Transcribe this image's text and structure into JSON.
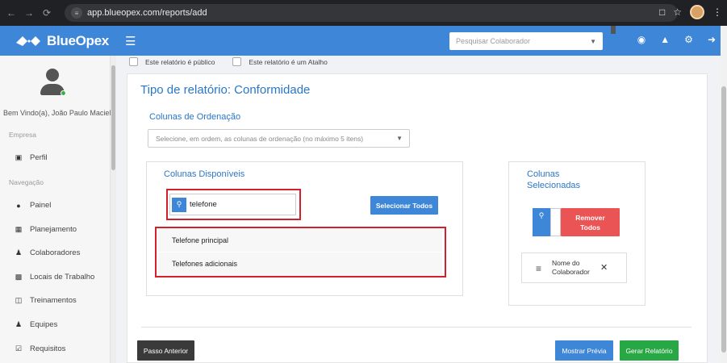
{
  "browser": {
    "url": "app.blueopex.com/reports/add"
  },
  "header": {
    "brand": "BlueOpex",
    "search_placeholder": "Pesquisar Colaborador"
  },
  "sidebar": {
    "welcome": "Bem Vindo(a), João Paulo Maciel",
    "section_company": "Empresa",
    "section_nav": "Navegação",
    "items_company": [
      {
        "label": "Perfil",
        "icon": "briefcase-icon"
      }
    ],
    "items_nav": [
      {
        "label": "Painel",
        "icon": "dashboard-icon"
      },
      {
        "label": "Planejamento",
        "icon": "calendar-icon"
      },
      {
        "label": "Colaboradores",
        "icon": "users-icon"
      },
      {
        "label": "Locais de Trabalho",
        "icon": "building-icon"
      },
      {
        "label": "Treinamentos",
        "icon": "training-icon"
      },
      {
        "label": "Equipes",
        "icon": "team-icon"
      },
      {
        "label": "Requisitos",
        "icon": "checkbox-icon"
      }
    ]
  },
  "options": {
    "public_label": "Este relatório é público",
    "shortcut_label": "Este relatório é um Atalho"
  },
  "report": {
    "title": "Tipo de relatório: Conformidade",
    "ordering_label": "Colunas de Ordenação",
    "ordering_placeholder": "Selecione, em ordem, as colunas de ordenação (no máximo 5 itens)",
    "available_title": "Colunas Disponíveis",
    "search_value": "telefone",
    "select_all": "Selecionar Todos",
    "results": [
      "Telefone principal",
      "Telefones adicionais"
    ],
    "selected_title_line1": "Colunas",
    "selected_title_line2": "Selecionadas",
    "remove_all_line1": "Remover",
    "remove_all_line2": "Todos",
    "selected_items": [
      {
        "line1": "Nome do",
        "line2": "Colaborador"
      }
    ]
  },
  "footer": {
    "prev": "Passo Anterior",
    "preview": "Mostrar Prévia",
    "generate": "Gerar Relatório"
  },
  "colors": {
    "brand": "#3d86d8",
    "danger": "#ea5455",
    "success": "#28a745",
    "dark": "#3a3a3a",
    "highlight": "#d4202c"
  }
}
